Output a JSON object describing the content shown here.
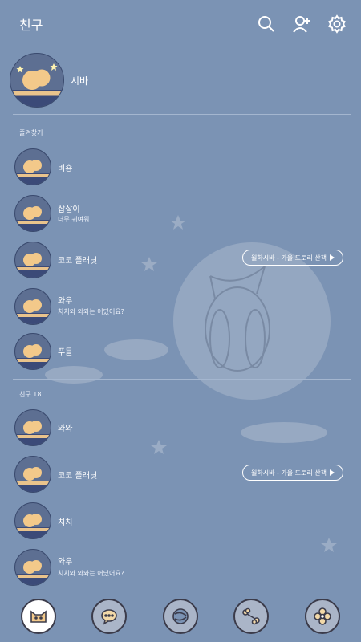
{
  "header": {
    "title": "친구",
    "icons": [
      "search-icon",
      "add-friend-icon",
      "settings-icon"
    ]
  },
  "profile": {
    "name": "시바"
  },
  "favorites": {
    "label": "즐겨찾기",
    "items": [
      {
        "name": "비숑",
        "status": ""
      },
      {
        "name": "삽살이",
        "status": "너무 귀여워"
      },
      {
        "name": "코코 플래닛",
        "status": "",
        "music": "월하시바 - 가을 도토리 산책"
      },
      {
        "name": "와우",
        "status": "치치와 와와는 어딨어요?"
      },
      {
        "name": "푸들",
        "status": ""
      }
    ]
  },
  "friends": {
    "label": "친구 18",
    "items": [
      {
        "name": "와와",
        "status": ""
      },
      {
        "name": "코코 플래닛",
        "status": "",
        "music": "월하시바 - 가을 도토리 산책"
      },
      {
        "name": "치치",
        "status": ""
      },
      {
        "name": "와우",
        "status": "치치와 와와는 어딨어요?"
      }
    ]
  },
  "tabs": [
    "friends-tab-icon",
    "chat-tab-icon",
    "openchat-tab-icon",
    "shopping-tab-icon",
    "more-tab-icon"
  ],
  "colors": {
    "background": "#7b93b4",
    "moon": "#aab8cc",
    "avatar_bg": "#5d6f92",
    "dog": "#f3c98a"
  }
}
